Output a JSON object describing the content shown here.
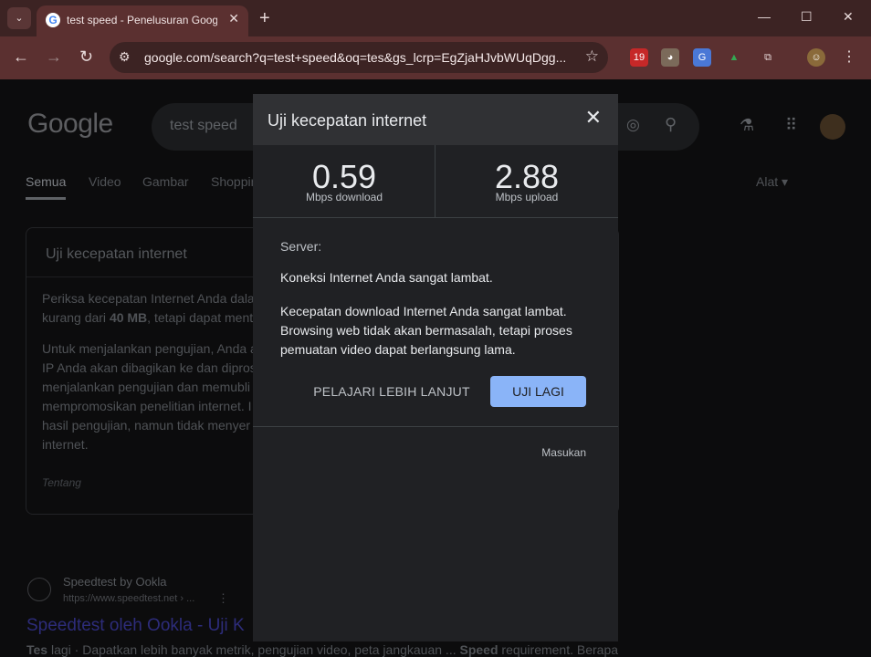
{
  "browser": {
    "tab_title": "test speed - Penelusuran Google",
    "tab_favicon": "G",
    "url": "google.com/search?q=test+speed&oq=tes&gs_lcrp=EgZjaHJvbWUqDgg...",
    "ext_badge": "19"
  },
  "google": {
    "logo": "Google",
    "search_value": "test speed",
    "tabs": [
      "Semua",
      "Video",
      "Gambar",
      "Shopping"
    ],
    "tools": "Alat",
    "card": {
      "title": "Uji kecepatan internet",
      "line1": "Periksa kecepatan Internet Anda dala",
      "line2_a": "kurang dari ",
      "line2_b": "40 MB",
      "line2_c": ", tetapi dapat ment",
      "para2": [
        "Untuk menjalankan pengujian, Anda a",
        "IP Anda akan dibagikan ke dan dipros",
        "menjalankan pengujian dan memubli",
        "mempromosikan penelitian internet. I",
        "hasil pengujian, namun tidak menyer",
        "internet."
      ],
      "about": "Tentang"
    },
    "result": {
      "site": "Speedtest by Ookla",
      "url": "https://www.speedtest.net › ...",
      "title": "Speedtest oleh Ookla - Uji K",
      "snippet_b1": "Tes",
      "snippet_mid": " lagi · Dapatkan lebih banyak metrik, pengujian video, peta jangkauan ... ",
      "snippet_b2": "Speed",
      "snippet_end": " requirement. Berapa"
    }
  },
  "modal": {
    "title": "Uji kecepatan internet",
    "download_value": "0.59",
    "download_label": "Mbps download",
    "upload_value": "2.88",
    "upload_label": "Mbps upload",
    "server_label": "Server:",
    "message1": "Koneksi Internet Anda sangat lambat.",
    "message2": "Kecepatan download Internet Anda sangat lambat. Browsing web tidak akan bermasalah, tetapi proses pemuatan video dapat berlangsung lama.",
    "learn_more": "PELAJARI LEBIH LANJUT",
    "retry": "UJI LAGI",
    "feedback": "Masukan"
  }
}
